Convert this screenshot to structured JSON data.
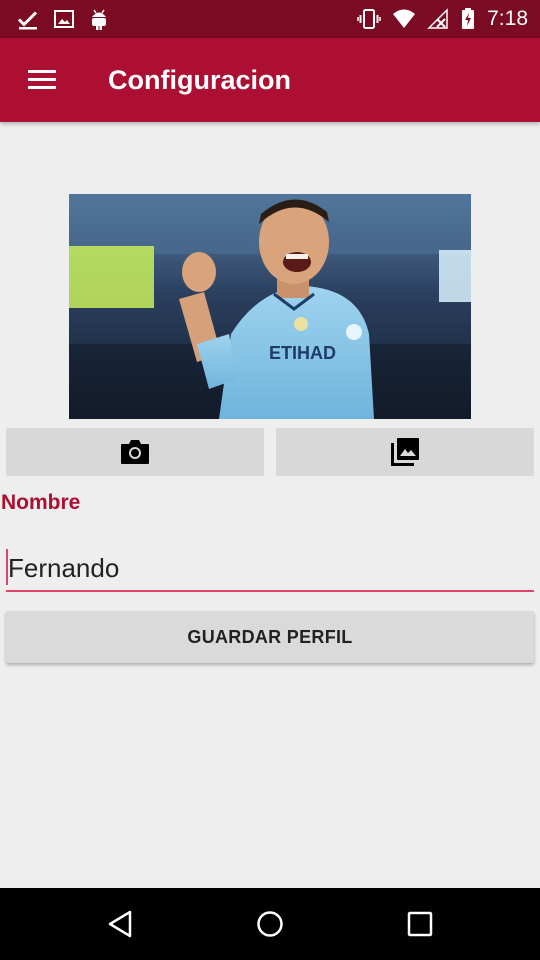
{
  "status_bar": {
    "time": "7:18",
    "icons_left": [
      "download-done-icon",
      "image-icon",
      "android-icon"
    ],
    "icons_right": [
      "vibrate-icon",
      "wifi-icon",
      "no-signal-icon",
      "battery-charging-icon"
    ]
  },
  "app_bar": {
    "title": "Configuracion",
    "menu_icon": "hamburger-menu-icon",
    "color": "#ad0f33"
  },
  "profile": {
    "photo_icon": "profile-photo",
    "camera_icon": "camera-icon",
    "gallery_icon": "photo-library-icon"
  },
  "form": {
    "name_label": "Nombre",
    "name_value": "Fernando",
    "save_label": "GUARDAR PERFIL",
    "accent_color": "#e0446a"
  },
  "nav_bar": {
    "icons": [
      "back-icon",
      "home-icon",
      "recents-icon"
    ]
  }
}
